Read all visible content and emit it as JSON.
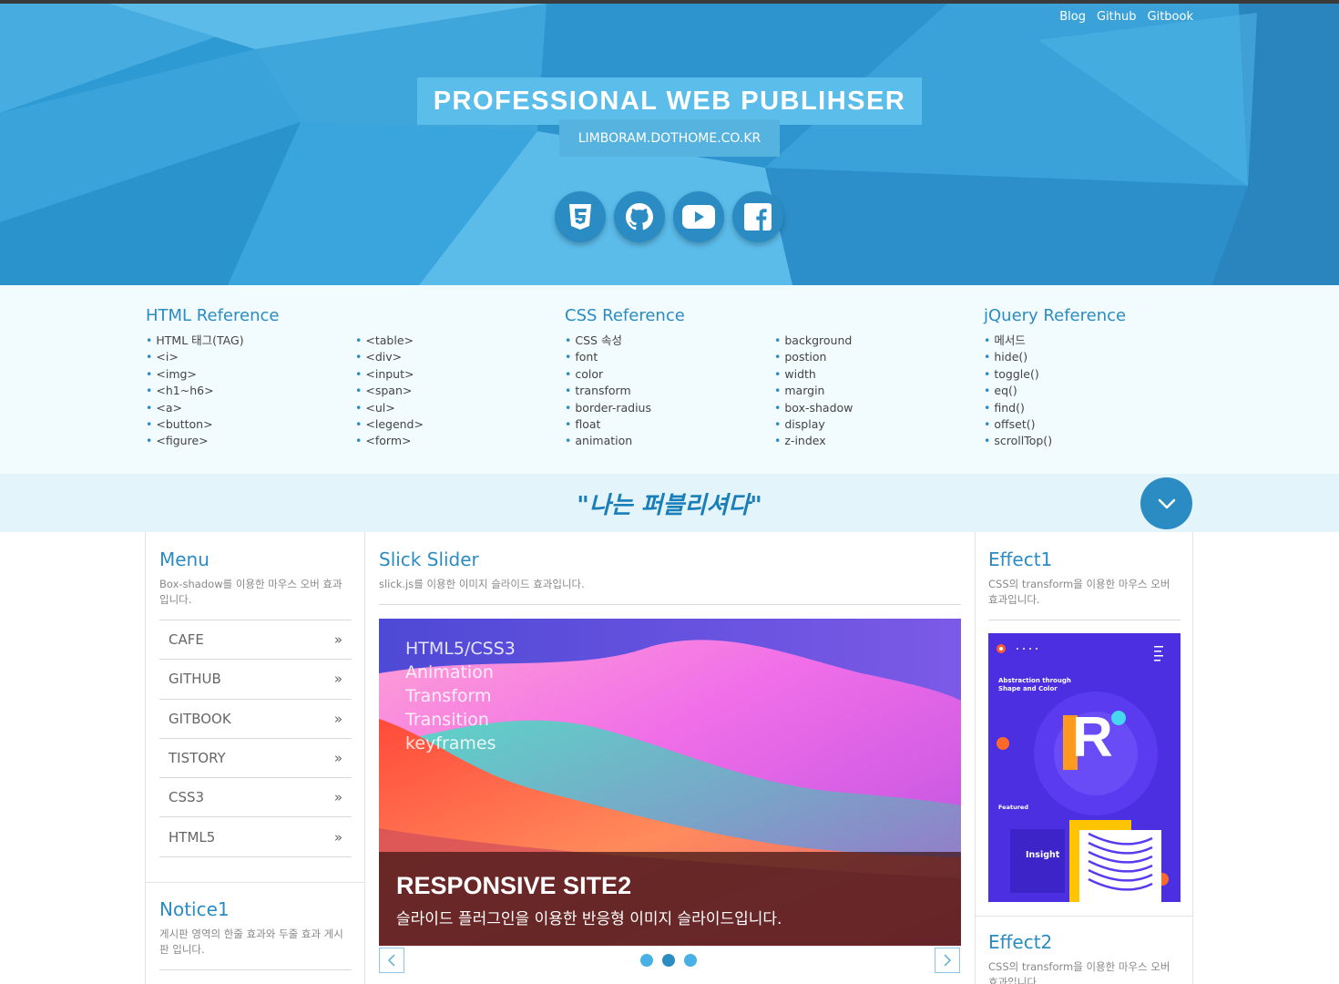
{
  "header": {
    "nav": [
      "Blog",
      "Github",
      "Gitbook"
    ],
    "title": "PROFESSIONAL WEB PUBLIHSER",
    "subtitle": "LIMBORAM.DOTHOME.CO.KR",
    "social_icons": [
      "css3-icon",
      "github-icon",
      "youtube-icon",
      "facebook-icon"
    ]
  },
  "reference": [
    {
      "title": "HTML Reference",
      "col1": [
        "HTML 태그(TAG)",
        "<i>",
        "<img>",
        "<h1~h6>",
        "<a>",
        "<button>",
        "<figure>"
      ],
      "col2": [
        "<table>",
        "<div>",
        "<input>",
        "<span>",
        "<ul>",
        "<legend>",
        "<form>"
      ]
    },
    {
      "title": "CSS Reference",
      "col1": [
        "CSS 속성",
        "font",
        "color",
        "transform",
        "border-radius",
        "float",
        "animation"
      ],
      "col2": [
        "background",
        "postion",
        "width",
        "margin",
        "box-shadow",
        "display",
        "z-index"
      ]
    },
    {
      "title": "jQuery Reference",
      "col1": [
        "메서드",
        "hide()",
        "toggle()",
        "eq()",
        "find()",
        "offset()",
        "scrollTop()"
      ],
      "col2": []
    }
  ],
  "slogan": "\"나는 퍼블리셔다\"",
  "menu": {
    "title": "Menu",
    "desc": "Box-shadow를 이용한 마우스 오버 효과입니다.",
    "items": [
      "CAFE",
      "GITHUB",
      "GITBOOK",
      "TISTORY",
      "CSS3",
      "HTML5"
    ],
    "arrow": "»"
  },
  "notice": {
    "title": "Notice1",
    "desc": "게시판 영역의 한줄 효과와 두줄 효과 게시판 입니다."
  },
  "slider": {
    "title": "Slick Slider",
    "desc": "slick.js를 이용한 이미지 슬라이드 효과입니다.",
    "lines": [
      "HTML5/CSS3",
      "Animation",
      "Transform",
      "Transition",
      "keyframes"
    ],
    "caption_title": "RESPONSIVE SITE2",
    "caption_desc": "슬라이드 플러그인을 이용한 반응형 이미지 슬라이드입니다.",
    "dots": 3,
    "active_dot": 1
  },
  "effect1": {
    "title": "Effect1",
    "desc": "CSS의 transform을 이용한 마우스 오버 효과입니다.",
    "poster_heading": "Abstraction through Shape and Color",
    "poster_letter": "R",
    "poster_featured": "Featured",
    "poster_insight": "Insight"
  },
  "effect2": {
    "title": "Effect2",
    "desc": "CSS의 transform을 이용한 마우스 오버 효과입니다."
  },
  "colors": {
    "accent": "#2a8cc2",
    "header_bg": "#2f9fd7",
    "reference_bg": "#f2fbfe",
    "slogan_bg": "#e3f4fb"
  }
}
